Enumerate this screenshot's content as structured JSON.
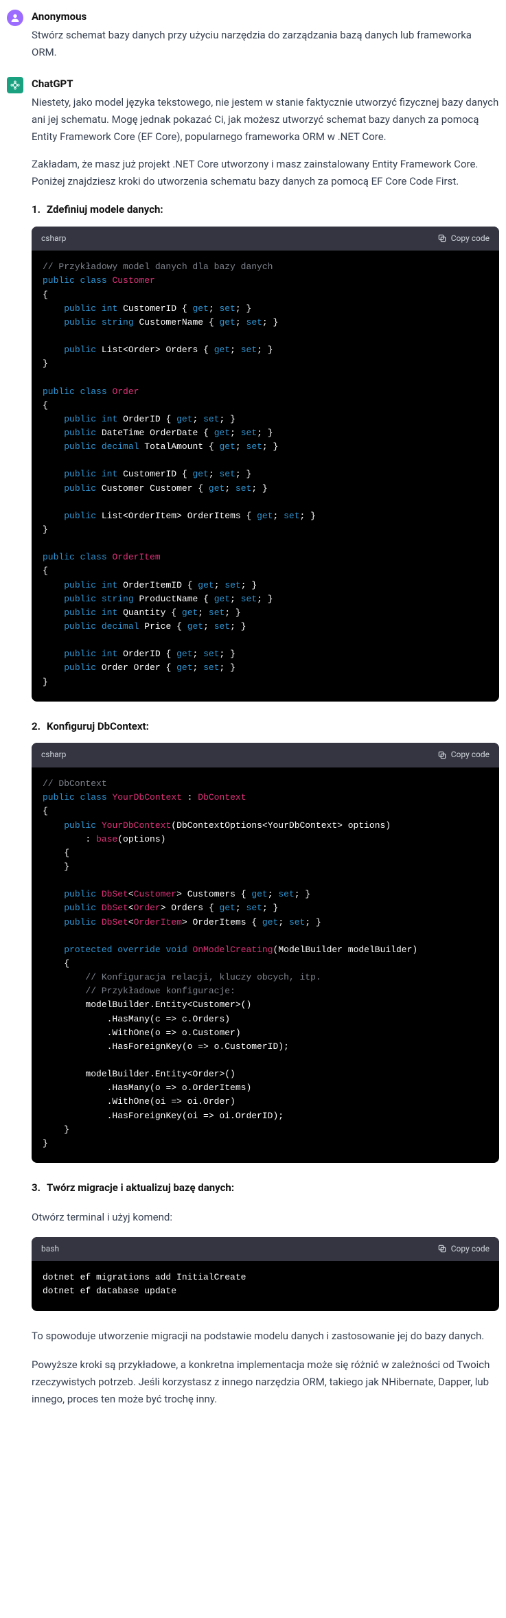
{
  "messages": {
    "user": {
      "author": "Anonymous",
      "text": "Stwórz schemat bazy danych przy użyciu narzędzia do zarządzania bazą danych lub frameworka ORM."
    },
    "assistant": {
      "author": "ChatGPT",
      "intro1": "Niestety, jako model języka tekstowego, nie jestem w stanie faktycznie utworzyć fizycznej bazy danych ani jej schematu. Mogę jednak pokazać Ci, jak możesz utworzyć schemat bazy danych za pomocą Entity Framework Core (EF Core), popularnego frameworka ORM w .NET Core.",
      "intro2": "Zakładam, że masz już projekt .NET Core utworzony i masz zainstalowany Entity Framework Core. Poniżej znajdziesz kroki do utworzenia schematu bazy danych za pomocą EF Core Code First.",
      "step1_title": "Zdefiniuj modele danych:",
      "step2_title": "Konfiguruj DbContext:",
      "step3_title": "Twórz migracje i aktualizuj bazę danych:",
      "open_terminal": "Otwórz terminal i użyj komend:",
      "closing1": "To spowoduje utworzenie migracji na podstawie modelu danych i zastosowanie jej do bazy danych.",
      "closing2": "Powyższe kroki są przykładowe, a konkretna implementacja może się różnić w zależności od Twoich rzeczywistych potrzeb. Jeśli korzystasz z innego narzędzia ORM, takiego jak NHibernate, Dapper, lub innego, proces ten może być trochę inny."
    }
  },
  "code": {
    "copy_label": "Copy code",
    "block1": {
      "lang": "csharp",
      "comment1": "// Przykładowy model danych dla bazy danych",
      "cls_customer": "Customer",
      "cls_order": "Order",
      "cls_orderitem": "OrderItem",
      "prop_customerid": "CustomerID",
      "prop_customername": "CustomerName",
      "prop_orders": "Orders",
      "prop_orderid": "OrderID",
      "prop_orderdate": "OrderDate",
      "prop_totalamount": "TotalAmount",
      "prop_customer": "Customer",
      "prop_orderitems": "OrderItems",
      "prop_orderitemid": "OrderItemID",
      "prop_productname": "ProductName",
      "prop_quantity": "Quantity",
      "prop_price": "Price",
      "prop_order": "Order",
      "t_int": "int",
      "t_string": "string",
      "t_listorder": "List<Order>",
      "t_datetime": "DateTime",
      "t_decimal": "decimal",
      "t_customer": "Customer",
      "t_listorderitem": "List<OrderItem>",
      "t_order": "Order"
    },
    "block2": {
      "lang": "csharp",
      "comment1": "// DbContext",
      "cls_ctx": "YourDbContext",
      "base_ctx": "DbContext",
      "ctor_param": "DbContextOptions<YourDbContext> options",
      "base_call": "base",
      "base_arg": "(options)",
      "dbset": "DbSet",
      "gen_customer": "Customer",
      "gen_order": "Order",
      "gen_orderitem": "OrderItem",
      "prop_customers": "Customers",
      "prop_orders": "Orders",
      "prop_orderitems": "OrderItems",
      "kw_protected": "protected",
      "kw_override": "override",
      "kw_void": "void",
      "m_onmodel": "OnModelCreating",
      "param_mb": "ModelBuilder modelBuilder",
      "comment2": "// Konfiguracja relacji, kluczy obcych, itp.",
      "comment3": "// Przykładowe konfiguracje:",
      "l1": "modelBuilder.Entity<Customer>()",
      "l2": ".HasMany(c => c.Orders)",
      "l3": ".WithOne(o => o.Customer)",
      "l4": ".HasForeignKey(o => o.CustomerID);",
      "l5": "modelBuilder.Entity<Order>()",
      "l6": ".HasMany(o => o.OrderItems)",
      "l7": ".WithOne(oi => oi.Order)",
      "l8": ".HasForeignKey(oi => oi.OrderID);"
    },
    "block3": {
      "lang": "bash",
      "line1": "dotnet ef migrations add InitialCreate",
      "line2": "dotnet ef database update"
    }
  },
  "kw": {
    "public": "public",
    "class": "class",
    "get": "get",
    "set": "set"
  }
}
